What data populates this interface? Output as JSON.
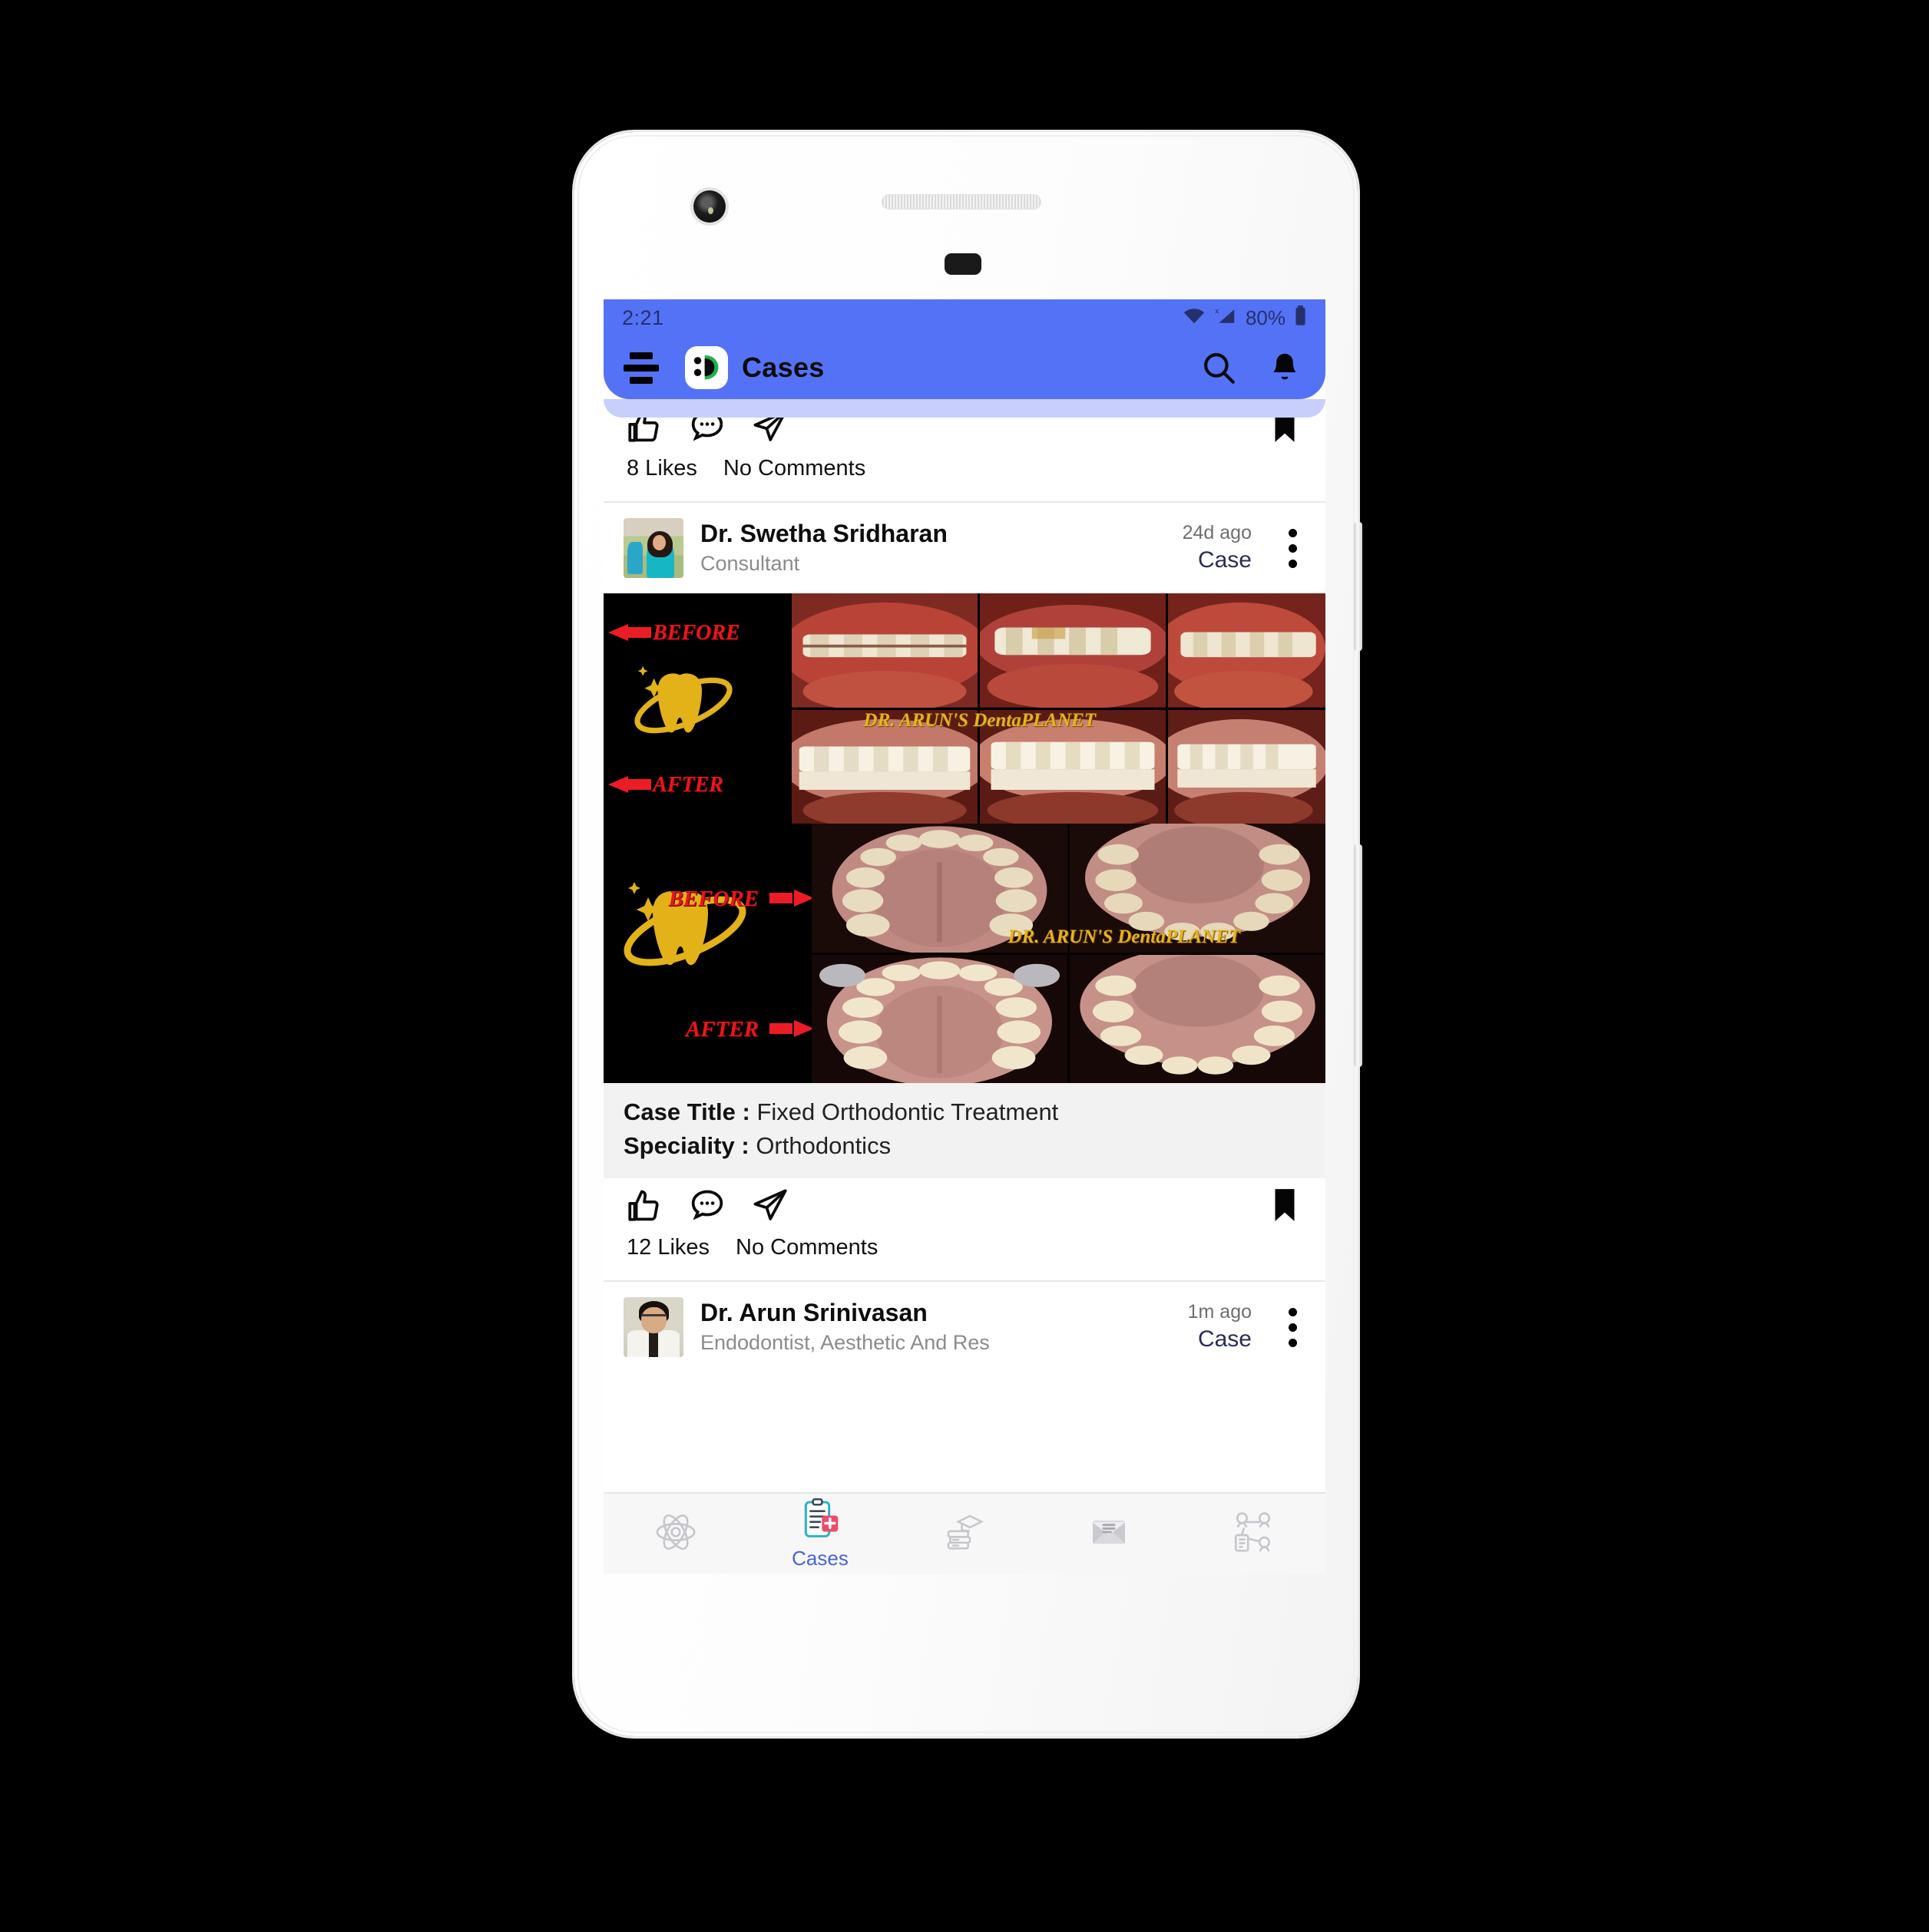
{
  "status_bar": {
    "time": "2:21",
    "battery_percent": "80%",
    "icons": [
      "wifi-icon",
      "cellular-signal-icon",
      "battery-icon"
    ]
  },
  "app_bar": {
    "menu_icon": "hamburger-menu-icon",
    "logo_icon": "dentalreach-logo-icon",
    "title": "Cases",
    "search_icon": "search-icon",
    "notification_icon": "bell-icon"
  },
  "colors": {
    "app_bar": "#5472f5",
    "accent": "#4a63d8",
    "case_label": "#2a2d56",
    "muted_text": "#8b8b8b",
    "case_info_bg": "#f2f2f2",
    "watermark": "#e8b21f",
    "before_after_label": "#e8161b"
  },
  "feed": {
    "partial_post_top": {
      "actions": {
        "like_icon": "thumbs-up-icon",
        "comment_icon": "comment-bubble-icon",
        "share_icon": "paper-plane-share-icon",
        "bookmark_icon": "bookmark-icon"
      },
      "likes": "8 Likes",
      "comments": "No Comments"
    },
    "posts": [
      {
        "author": {
          "name": "Dr. Swetha Sridharan",
          "role": "Consultant",
          "avatar_icon": "avatar-swetha-sridharan"
        },
        "timestamp": "24d ago",
        "post_type": "Case",
        "menu_icon": "kebab-menu-icon",
        "media": {
          "type": "before-after-collage",
          "watermark": "DR. ARUN'S DentaPLANET",
          "labels": {
            "before": "BEFORE",
            "after": "AFTER"
          },
          "logo_icon": "tooth-planet-logo-icon",
          "top_collage_photos": 6,
          "bottom_collage_photos": 4
        },
        "details": [
          {
            "label": "Case Title :",
            "value": "Fixed Orthodontic Treatment"
          },
          {
            "label": "Speciality :",
            "value": "Orthodontics"
          }
        ],
        "actions": {
          "like_icon": "thumbs-up-icon",
          "comment_icon": "comment-bubble-icon",
          "share_icon": "paper-plane-share-icon",
          "bookmark_icon": "bookmark-icon"
        },
        "likes": "12 Likes",
        "comments": "No Comments"
      },
      {
        "author": {
          "name": "Dr. Arun Srinivasan",
          "role": "Endodontist, Aesthetic And Res",
          "avatar_icon": "avatar-arun-srinivasan"
        },
        "timestamp": "1m ago",
        "post_type": "Case",
        "menu_icon": "kebab-menu-icon"
      }
    ]
  },
  "bottom_nav": [
    {
      "id": "research",
      "icon": "atom-icon",
      "label": "",
      "active": false
    },
    {
      "id": "cases",
      "icon": "clipboard-case-icon",
      "label": "Cases",
      "active": true
    },
    {
      "id": "education",
      "icon": "graduation-books-icon",
      "label": "",
      "active": false
    },
    {
      "id": "messages",
      "icon": "envelope-icon",
      "label": "",
      "active": false
    },
    {
      "id": "network",
      "icon": "people-network-icon",
      "label": "",
      "active": false
    }
  ]
}
